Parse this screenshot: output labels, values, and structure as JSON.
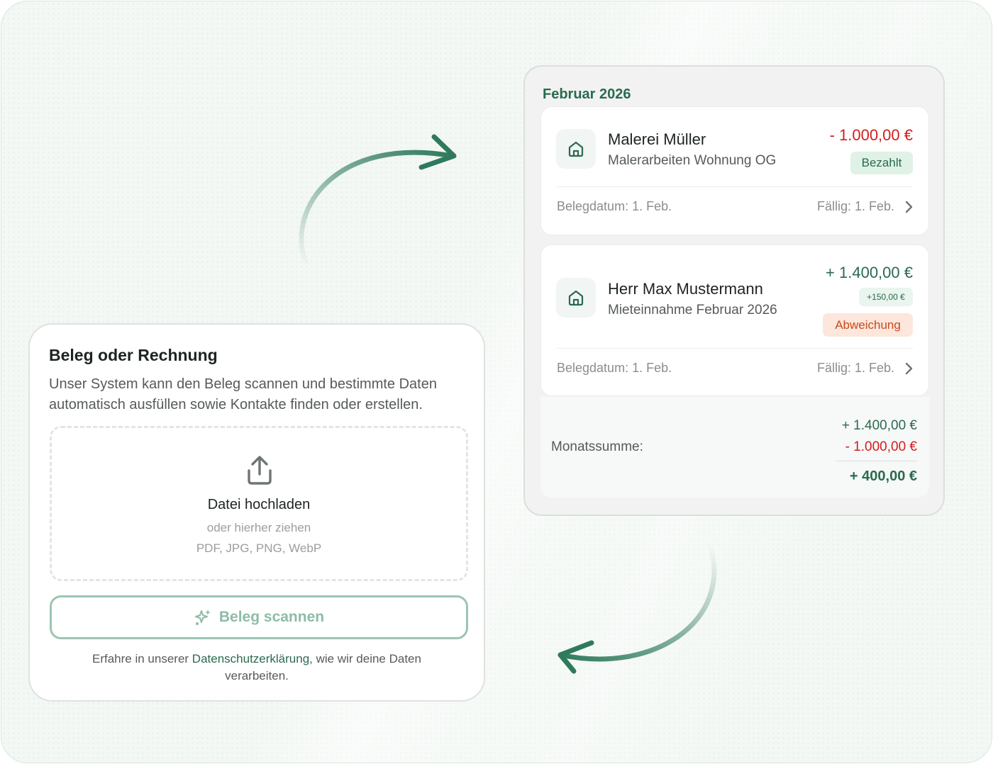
{
  "upload": {
    "title": "Beleg oder Rechnung",
    "description": "Unser System kann den Beleg scannen und bestimmte Daten automatisch ausfüllen sowie Kontakte finden oder erstellen.",
    "dropzone": {
      "title": "Datei hochladen",
      "subtitle": "oder hierher ziehen",
      "formats": "PDF, JPG, PNG, WebP",
      "icon": "upload-icon"
    },
    "scan_button": {
      "label": "Beleg scannen",
      "icon": "sparkle-icon"
    },
    "privacy": {
      "prefix": "Erfahre in unserer ",
      "link": "Datenschutzerklärung",
      "suffix": ", wie wir deine Daten verarbeiten."
    }
  },
  "finance": {
    "month": "Februar 2026",
    "transactions": [
      {
        "icon": "house-icon",
        "name": "Malerei Müller",
        "description": "Malerarbeiten Wohnung OG",
        "amount": "- 1.000,00 €",
        "status": "Bezahlt",
        "receipt_date": "Belegdatum: 1. Feb.",
        "due_date": "Fällig: 1. Feb."
      },
      {
        "icon": "house-icon",
        "name": "Herr Max Mustermann",
        "description": "Mieteinnahme Februar 2026",
        "amount": "+ 1.400,00 €",
        "difference": "+150,00 €",
        "status": "Abweichung",
        "receipt_date": "Belegdatum: 1. Feb.",
        "due_date": "Fällig: 1. Feb."
      }
    ],
    "summary": {
      "label": "Monatssumme:",
      "income": "+ 1.400,00 €",
      "expense": "- 1.000,00 €",
      "total": "+ 400,00 €"
    }
  },
  "colors": {
    "accent": "#2a6a4f",
    "negative": "#d31d1d",
    "warning": "#c84a1d",
    "scan_button": "#8fbba6"
  }
}
